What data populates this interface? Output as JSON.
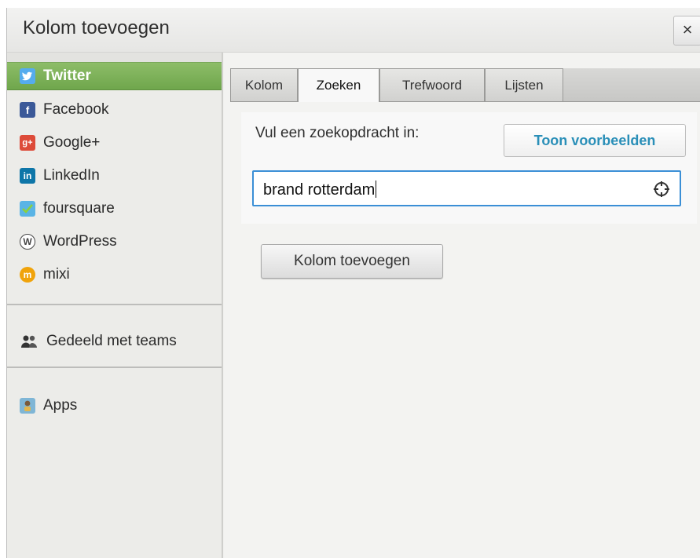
{
  "dialog": {
    "title": "Kolom toevoegen",
    "close_label": "×"
  },
  "sidebar": {
    "networks": [
      {
        "label": "Twitter",
        "icon": "twitter-icon",
        "color": "#55acee",
        "active": true
      },
      {
        "label": "Facebook",
        "icon": "facebook-icon",
        "color": "#3b5998"
      },
      {
        "label": "Google+",
        "icon": "google-plus-icon",
        "color": "#dd4b39"
      },
      {
        "label": "LinkedIn",
        "icon": "linkedin-icon",
        "color": "#0e76a8"
      },
      {
        "label": "foursquare",
        "icon": "foursquare-icon",
        "color": "#5ab4e5"
      },
      {
        "label": "WordPress",
        "icon": "wordpress-icon",
        "color": "#464646"
      },
      {
        "label": "mixi",
        "icon": "mixi-icon",
        "color": "#f0a30a"
      }
    ],
    "shared": {
      "label": "Gedeeld met teams",
      "icon": "team-icon"
    },
    "apps": {
      "label": "Apps",
      "icon": "apps-icon"
    }
  },
  "tabs": [
    {
      "label": "Kolom"
    },
    {
      "label": "Zoeken",
      "active": true
    },
    {
      "label": "Trefwoord"
    },
    {
      "label": "Lijsten"
    }
  ],
  "search": {
    "prompt": "Vul een zoekopdracht in:",
    "examples_button": "Toon voorbeelden",
    "query": "brand rotterdam"
  },
  "actions": {
    "add_column": "Kolom toevoegen"
  },
  "colors": {
    "active_green": "#7ab356",
    "link_blue": "#2a8fb8",
    "focus_blue": "#3b8fd6"
  }
}
